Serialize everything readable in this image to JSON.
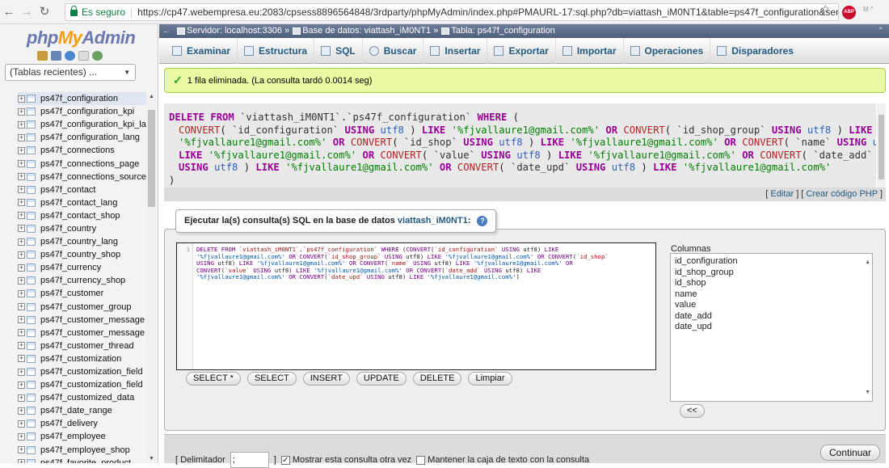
{
  "browser": {
    "secure_label": "Es seguro",
    "url": "https://cp47.webempresa.eu:2083/cpsess8896564848/3rdparty/phpMyAdmin/index.php#PMAURL-17:sql.php?db=viattash_iM0NT1&table=ps47f_configuration&server=",
    "ext_label": "ABP"
  },
  "sidebar": {
    "logo_php": "php",
    "logo_my": "My",
    "logo_admin": "Admin",
    "recent": "(Tablas recientes) ...",
    "tables": [
      "ps47f_configuration",
      "ps47f_configuration_kpi",
      "ps47f_configuration_kpi_la",
      "ps47f_configuration_lang",
      "ps47f_connections",
      "ps47f_connections_page",
      "ps47f_connections_source",
      "ps47f_contact",
      "ps47f_contact_lang",
      "ps47f_contact_shop",
      "ps47f_country",
      "ps47f_country_lang",
      "ps47f_country_shop",
      "ps47f_currency",
      "ps47f_currency_shop",
      "ps47f_customer",
      "ps47f_customer_group",
      "ps47f_customer_message",
      "ps47f_customer_message",
      "ps47f_customer_thread",
      "ps47f_customization",
      "ps47f_customization_field",
      "ps47f_customization_field",
      "ps47f_customized_data",
      "ps47f_date_range",
      "ps47f_delivery",
      "ps47f_employee",
      "ps47f_employee_shop",
      "ps47f_favorite_product"
    ]
  },
  "breadcrumb": {
    "server": "Servidor: localhost:3306",
    "database": "Base de datos: viattash_iM0NT1",
    "table": "Tabla: ps47f_configuration"
  },
  "tabs": [
    "Examinar",
    "Estructura",
    "SQL",
    "Buscar",
    "Insertar",
    "Exportar",
    "Importar",
    "Operaciones",
    "Disparadores"
  ],
  "message": "1 fila eliminada. (La consulta tardó 0.0014 seg)",
  "actions": {
    "edit": "Editar",
    "php": "Crear código PHP"
  },
  "query_panel": {
    "legend": "Ejecutar la(s) consulta(s) SQL en la base de datos",
    "database": "viattash_iM0NT1",
    "line_number": "1",
    "buttons": [
      "SELECT *",
      "SELECT",
      "INSERT",
      "UPDATE",
      "DELETE",
      "Limpiar"
    ],
    "columns_label": "Columnas",
    "columns": [
      "id_configuration",
      "id_shop_group",
      "id_shop",
      "name",
      "value",
      "date_add",
      "date_upd"
    ],
    "insert_btn": "<<"
  },
  "bottom": {
    "delimiter_label": "[ Delimitador",
    "delimiter_value": ";",
    "show_again": "Mostrar esta consulta otra vez",
    "keep_box": "Mantener la caja de texto con la consulta",
    "submit": "Continuar"
  },
  "colors": {
    "accent": "#235a81",
    "success_bg": "#ebf8a4",
    "logo_php": "#6c78af",
    "logo_my": "#f89c0e"
  }
}
